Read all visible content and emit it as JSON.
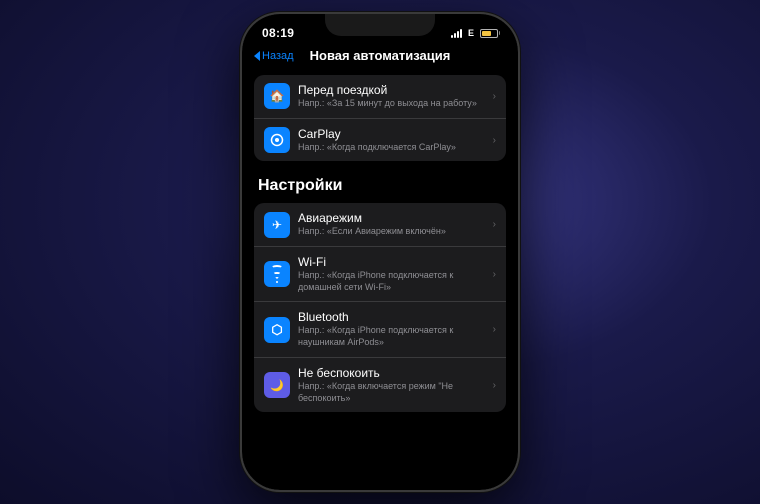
{
  "status_bar": {
    "time": "08:19",
    "signal_letter": "E",
    "battery_level": 65
  },
  "nav": {
    "back_label": "Назад",
    "title": "Новая автоматизация"
  },
  "sections": [
    {
      "id": "travel",
      "header": "",
      "items": [
        {
          "id": "before-trip",
          "title": "Перед поездкой",
          "subtitle": "Напр.: «За 15 минут до выхода на работу»",
          "icon_type": "house"
        },
        {
          "id": "carplay",
          "title": "CarPlay",
          "subtitle": "Напр.: «Когда подключается CarPlay»",
          "icon_type": "carplay"
        }
      ]
    },
    {
      "id": "settings",
      "header": "Настройки",
      "items": [
        {
          "id": "airplane",
          "title": "Авиарежим",
          "subtitle": "Напр.: «Если Авиарежим включён»",
          "icon_type": "airplane"
        },
        {
          "id": "wifi",
          "title": "Wi-Fi",
          "subtitle": "Напр.: «Когда iPhone подключается к домашней сети Wi-Fi»",
          "icon_type": "wifi"
        },
        {
          "id": "bluetooth",
          "title": "Bluetooth",
          "subtitle": "Напр.: «Когда iPhone подключается к наушникам AirPods»",
          "icon_type": "bluetooth"
        },
        {
          "id": "do-not-disturb",
          "title": "Не беспокоить",
          "subtitle": "Напр.: «Когда включается режим \"Не беспокоить»",
          "icon_type": "moon"
        }
      ]
    }
  ]
}
